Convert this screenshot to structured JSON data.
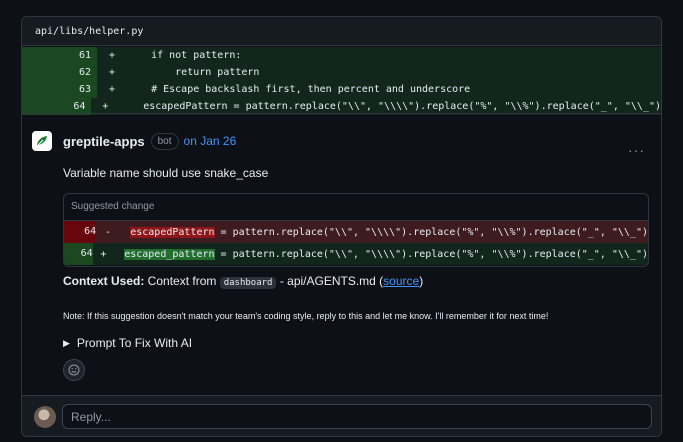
{
  "file": {
    "path": "api/libs/helper.py"
  },
  "diff_lines": [
    {
      "num": "61",
      "sign": "+",
      "code": "    if not pattern:"
    },
    {
      "num": "62",
      "sign": "+",
      "code": "        return pattern"
    },
    {
      "num": "63",
      "sign": "+",
      "code": "    # Escape backslash first, then percent and underscore"
    },
    {
      "num": "64",
      "sign": "+",
      "code": "    escapedPattern = pattern.replace(\"\\\\\", \"\\\\\\\\\").replace(\"%\", \"\\\\%\").replace(\"_\", \"\\\\_\")"
    }
  ],
  "comment": {
    "author": "greptile-apps",
    "badge": "bot",
    "date": "on Jan 26",
    "menu": "···",
    "message": "Variable name should use snake_case",
    "suggestion_title": "Suggested change",
    "suggestion": {
      "del": {
        "num": "64",
        "sign": "-",
        "var": "escapedPattern",
        "rest": " = pattern.replace(\"\\\\\", \"\\\\\\\\\").replace(\"%\", \"\\\\%\").replace(\"_\", \"\\\\_\")"
      },
      "add": {
        "num": "64",
        "sign": "+",
        "var": "escaped_pattern",
        "rest": " = pattern.replace(\"\\\\\", \"\\\\\\\\\").replace(\"%\", \"\\\\%\").replace(\"_\", \"\\\\_\")"
      }
    },
    "context_label": "Context Used:",
    "context_prefix": " Context from ",
    "context_tag": "dashboard",
    "context_mid": " - api/AGENTS.md (",
    "context_link": "source",
    "context_suffix": ")",
    "note": "Note: If this suggestion doesn't match your team's coding style, reply to this and let me know. I'll remember it for next time!",
    "prompt_toggle": "Prompt To Fix With AI"
  },
  "reply": {
    "placeholder": "Reply..."
  },
  "icons": [
    "greptile-logo-icon",
    "kebab-menu-icon",
    "triangle-right-icon",
    "smiley-icon",
    "user-avatar"
  ],
  "colors": {
    "added_bg": "#12261e",
    "deleted_bg": "#3d1b1f",
    "link": "#4493f8"
  }
}
